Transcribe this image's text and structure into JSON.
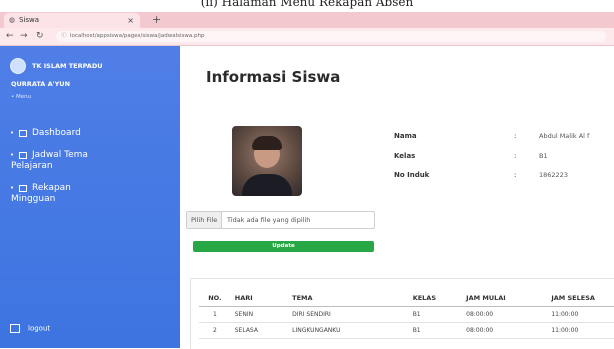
{
  "caption": "(ii) Halaman Menu Rekapan Absen",
  "browser": {
    "tab_title": "Siswa",
    "tab_close": "×",
    "new_tab": "+",
    "url": "localhost/appsiswa/pages/siswa/jadwalsiswa.php"
  },
  "sidebar": {
    "school_line1": "TK ISLAM TERPADU",
    "school_line2": "QURRATA A'YUN",
    "menu_heading": "Menu",
    "items": [
      {
        "label": "Dashboard",
        "icon": "grid-icon"
      },
      {
        "label_line1": "Jadwal Tema",
        "label_line2": "Pelajaran",
        "icon": "grid-icon"
      },
      {
        "label_line1": "Rekapan",
        "label_line2": "Mingguan",
        "icon": "grid-icon"
      }
    ],
    "logout": "logout"
  },
  "main": {
    "title": "Informasi Siswa",
    "fields": [
      {
        "key": "Nama",
        "sep": ":",
        "value": "Abdul Malik Al f"
      },
      {
        "key": "Kelas",
        "sep": ":",
        "value": "B1"
      },
      {
        "key": "No Induk",
        "sep": ":",
        "value": "1862223"
      }
    ],
    "file_button": "Pilih File",
    "file_status": "Tidak ada file yang dipilih",
    "update_button": "Update"
  },
  "table": {
    "headers": [
      "NO.",
      "HARI",
      "TEMA",
      "KELAS",
      "JAM MULAI",
      "JAM SELESA"
    ],
    "rows": [
      [
        "1",
        "SENIN",
        "DIRI SENDIRI",
        "B1",
        "08:00:00",
        "11:00:00"
      ],
      [
        "2",
        "SELASA",
        "LINGKUNGANKU",
        "B1",
        "08:00:00",
        "11:00:00"
      ]
    ]
  }
}
